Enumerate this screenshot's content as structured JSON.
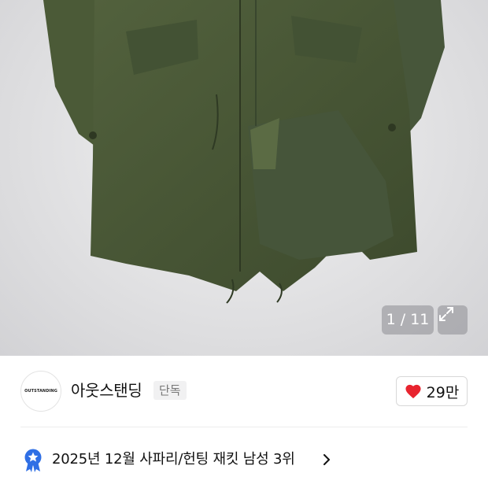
{
  "gallery": {
    "counter": "1 / 11",
    "image_alt": "olive green fishtail parka product photo",
    "background_color": "#dcdcde",
    "garment_color": "#4a5a37"
  },
  "brand": {
    "logo_text": "OUTSTANDING",
    "name": "아웃스탠딩",
    "badge": "단독"
  },
  "like": {
    "count": "29만",
    "icon": "heart-icon",
    "color": "#e8242f"
  },
  "ranking": {
    "icon": "star-ribbon-icon",
    "text": "2025년 12월 사파리/헌팅 재킷 남성 3위",
    "icon_color": "#2f6fe5"
  }
}
